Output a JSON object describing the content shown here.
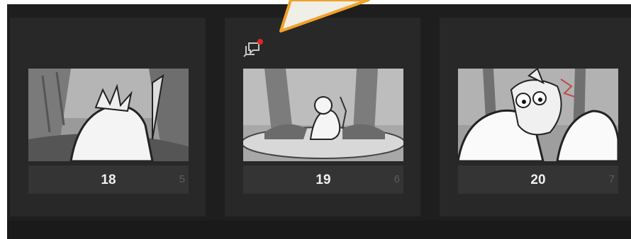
{
  "storyboard": {
    "cards": [
      {
        "scene": "18",
        "sub": "5",
        "has_comment": false
      },
      {
        "scene": "19",
        "sub": "6",
        "has_comment": true
      },
      {
        "scene": "20",
        "sub": "7",
        "has_comment": false
      }
    ]
  },
  "colors": {
    "comment_dot": "#e0281c",
    "callout_fill": "#efeee7",
    "callout_stroke": "#f0a229"
  },
  "icons": {
    "comment": "comment-notification-icon"
  }
}
